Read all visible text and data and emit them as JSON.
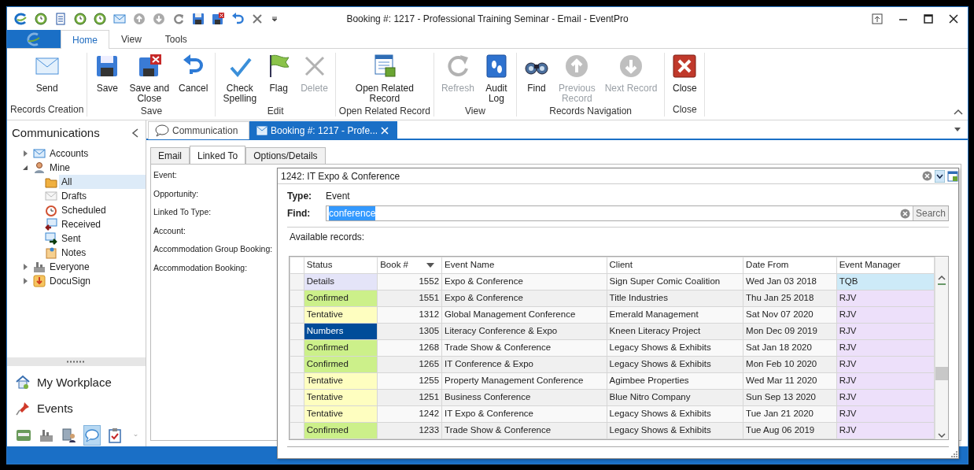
{
  "window": {
    "title": "Booking #: 1217 - Professional Training Seminar - Email - EventPro"
  },
  "ribbon": {
    "tabs": [
      {
        "label": "Home",
        "selected": true
      },
      {
        "label": "View",
        "selected": false
      },
      {
        "label": "Tools",
        "selected": false
      }
    ],
    "groups": [
      {
        "label": "Records Creation",
        "buttons": [
          {
            "lines": [
              "Send"
            ],
            "disabled": false
          }
        ]
      },
      {
        "label": "Save",
        "buttons": [
          {
            "lines": [
              "Save"
            ],
            "disabled": false
          },
          {
            "lines": [
              "Save and",
              "Close"
            ],
            "disabled": false
          },
          {
            "lines": [
              "Cancel"
            ],
            "disabled": false
          }
        ]
      },
      {
        "label": "Edit",
        "buttons": [
          {
            "lines": [
              "Check",
              "Spelling"
            ],
            "disabled": false
          },
          {
            "lines": [
              "Flag"
            ],
            "disabled": false
          },
          {
            "lines": [
              "Delete"
            ],
            "disabled": true
          }
        ]
      },
      {
        "label": "Open Related Record",
        "buttons": [
          {
            "lines": [
              "Open Related",
              "Record"
            ],
            "disabled": false
          }
        ]
      },
      {
        "label": "View",
        "buttons": [
          {
            "lines": [
              "Refresh"
            ],
            "disabled": true
          },
          {
            "lines": [
              "Audit",
              "Log"
            ],
            "disabled": false
          }
        ]
      },
      {
        "label": "Records Navigation",
        "buttons": [
          {
            "lines": [
              "Find"
            ],
            "disabled": false
          },
          {
            "lines": [
              "Previous",
              "Record"
            ],
            "disabled": true
          },
          {
            "lines": [
              "Next Record"
            ],
            "disabled": true
          }
        ]
      },
      {
        "label": "Close",
        "buttons": [
          {
            "lines": [
              "Close"
            ],
            "disabled": false
          }
        ]
      }
    ]
  },
  "sidebar": {
    "title": "Communications",
    "tree": [
      {
        "label": "Accounts",
        "expanded": false,
        "selected": false
      },
      {
        "label": "Mine",
        "expanded": true,
        "selected": false,
        "children": [
          {
            "label": "All",
            "selected": true
          },
          {
            "label": "Drafts",
            "selected": false
          },
          {
            "label": "Scheduled",
            "selected": false
          },
          {
            "label": "Received",
            "selected": false
          },
          {
            "label": "Sent",
            "selected": false
          },
          {
            "label": "Notes",
            "selected": false
          }
        ]
      },
      {
        "label": "Everyone",
        "expanded": false,
        "selected": false
      },
      {
        "label": "DocuSign",
        "expanded": false,
        "selected": false
      }
    ],
    "nav": [
      {
        "label": "My Workplace"
      },
      {
        "label": "Events"
      }
    ],
    "shortcuts": [
      {
        "selected": false
      },
      {
        "selected": false
      },
      {
        "selected": false
      },
      {
        "selected": true
      },
      {
        "selected": false
      }
    ]
  },
  "document_tabs": [
    {
      "label": "Communication",
      "selected": false
    },
    {
      "label": "Booking #: 1217 - Profe...",
      "selected": true
    }
  ],
  "editor_tabs": [
    {
      "label": "Email",
      "selected": false
    },
    {
      "label": "Linked To",
      "selected": true
    },
    {
      "label": "Options/Details",
      "selected": false
    }
  ],
  "form": {
    "labels": [
      "Event:",
      "Opportunity:",
      "Linked To Type:",
      "Account:",
      "Accommodation Group Booking:",
      "Accommodation Booking:"
    ]
  },
  "lookup": {
    "value": "1242: IT Expo & Conference",
    "type_label": "Type:",
    "type_value": "Event",
    "find_label": "Find:",
    "find_value": "conference",
    "find_text_selected": true,
    "search_button": "Search",
    "records_label": "Available records:",
    "table": {
      "columns": [
        {
          "label": "Status"
        },
        {
          "label": "Book #",
          "sort_descending": true
        },
        {
          "label": "Event Name"
        },
        {
          "label": "Client"
        },
        {
          "label": "Date From"
        },
        {
          "label": "Event Manager"
        }
      ],
      "rows": [
        {
          "status": "Details",
          "color": "#e4e4f8",
          "book": "1552",
          "event_name": "Expo & Conference",
          "client": "Sign Super Comic Coalition",
          "date_from": "Wed Jan 03 2018",
          "event_manager": "TQB",
          "focused": true
        },
        {
          "status": "Confirmed",
          "color": "#ccf08a",
          "book": "1551",
          "event_name": "Expo & Conference",
          "client": "Title Industries",
          "date_from": "Thu Jan 25 2018",
          "event_manager": "RJV",
          "focused": false
        },
        {
          "status": "Tentative",
          "color": "#fefec0",
          "book": "1312",
          "event_name": "Global Management Conference",
          "client": "Emerald Management",
          "date_from": "Sat Nov 07 2020",
          "event_manager": "RJV",
          "focused": false
        },
        {
          "status": "Numbers",
          "color": "#004c99",
          "book": "1305",
          "event_name": "Literacy Conference & Expo",
          "client": "Kneen Literacy Project",
          "date_from": "Mon Dec 09 2019",
          "event_manager": "RJV",
          "focused": false
        },
        {
          "status": "Confirmed",
          "color": "#ccf08a",
          "book": "1268",
          "event_name": "Trade Show & Conference",
          "client": "Legacy Shows & Exhibits",
          "date_from": "Sat Jan 18 2020",
          "event_manager": "RJV",
          "focused": false
        },
        {
          "status": "Confirmed",
          "color": "#ccf08a",
          "book": "1265",
          "event_name": "IT Conference & Expo",
          "client": "Legacy Shows & Exhibits",
          "date_from": "Mon Feb 10 2020",
          "event_manager": "RJV",
          "focused": false
        },
        {
          "status": "Tentative",
          "color": "#fefec0",
          "book": "1255",
          "event_name": "Property Management Conference",
          "client": "Agimbee Properties",
          "date_from": "Wed Mar 11 2020",
          "event_manager": "RJV",
          "focused": false
        },
        {
          "status": "Tentative",
          "color": "#fefec0",
          "book": "1251",
          "event_name": "Business Conference",
          "client": "Blue Nitro Company",
          "date_from": "Sun Sep 13 2020",
          "event_manager": "RJV",
          "focused": false
        },
        {
          "status": "Tentative",
          "color": "#fefec0",
          "book": "1242",
          "event_name": "IT Expo & Conference",
          "client": "Legacy Shows & Exhibits",
          "date_from": "Tue Jan 21 2020",
          "event_manager": "RJV",
          "focused": false
        },
        {
          "status": "Confirmed",
          "color": "#ccf08a",
          "book": "1233",
          "event_name": "Trade Show & Conference",
          "client": "Legacy Shows & Exhibits",
          "date_from": "Tue Aug 06 2019",
          "event_manager": "RJV",
          "focused": false
        }
      ]
    }
  }
}
